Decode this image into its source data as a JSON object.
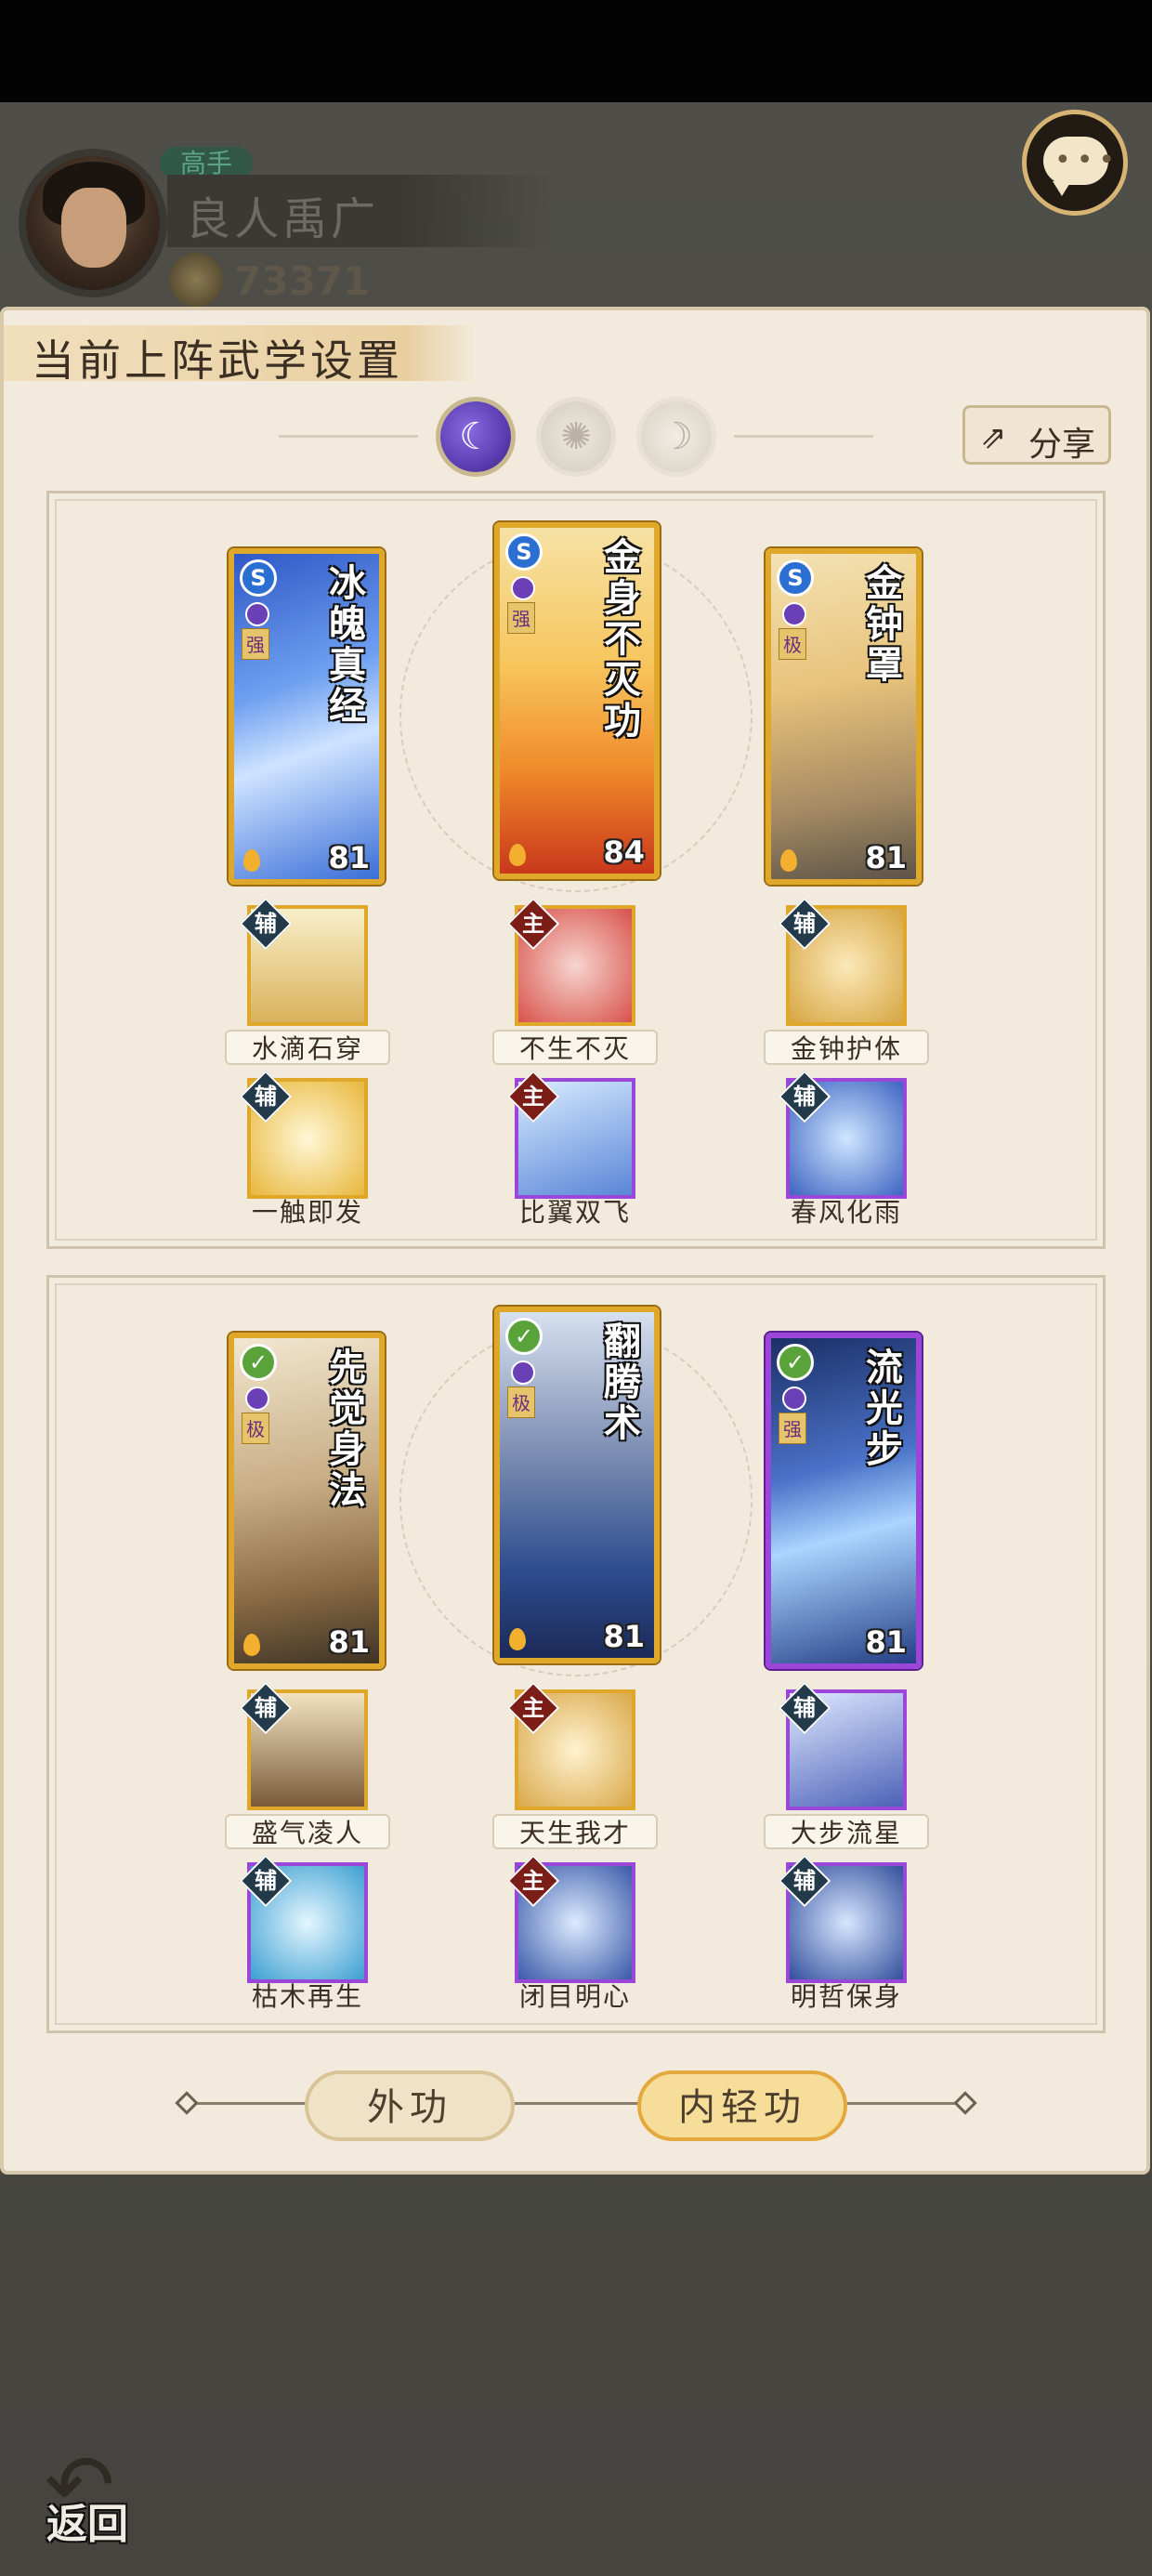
{
  "player": {
    "rank": "高手",
    "name": "良人禹广",
    "coins": "73371"
  },
  "panel": {
    "title": "当前上阵武学设置",
    "share_label": "分享",
    "tabs": [
      {
        "icon": "purple-moon-icon",
        "active": true
      },
      {
        "icon": "sun-icon",
        "active": false
      },
      {
        "icon": "crescent-icon",
        "active": false
      }
    ]
  },
  "section1": {
    "cards": [
      {
        "title": "冰魄真经",
        "tier": "强",
        "level": "81",
        "type": "S"
      },
      {
        "title": "金身不灭功",
        "tier": "强",
        "level": "84",
        "type": "S"
      },
      {
        "title": "金钟罩",
        "tier": "极",
        "level": "81",
        "type": "S"
      }
    ],
    "skills_row1": [
      {
        "label": "水滴石穿",
        "badge": "辅"
      },
      {
        "label": "不生不灭",
        "badge": "主"
      },
      {
        "label": "金钟护体",
        "badge": "辅"
      }
    ],
    "skills_row2": [
      {
        "label": "一触即发",
        "badge": "辅"
      },
      {
        "label": "比翼双飞",
        "badge": "主"
      },
      {
        "label": "春风化雨",
        "badge": "辅"
      }
    ]
  },
  "section2": {
    "cards": [
      {
        "title": "先觉身法",
        "tier": "极",
        "level": "81"
      },
      {
        "title": "翻腾术",
        "tier": "极",
        "level": "81"
      },
      {
        "title": "流光步",
        "tier": "强",
        "level": "81"
      }
    ],
    "skills_row1": [
      {
        "label": "盛气凌人",
        "badge": "辅"
      },
      {
        "label": "天生我才",
        "badge": "主"
      },
      {
        "label": "大步流星",
        "badge": "辅"
      }
    ],
    "skills_row2": [
      {
        "label": "枯木再生",
        "badge": "辅"
      },
      {
        "label": "闭目明心",
        "badge": "主"
      },
      {
        "label": "明哲保身",
        "badge": "辅"
      }
    ]
  },
  "bottom_tabs": {
    "outer": "外功",
    "inner": "内轻功"
  },
  "back_label": "返回",
  "colors": {
    "gold_frame": "#e0a82a",
    "purple_frame": "#9a46d8",
    "panel_bg": "#f2ebdd"
  }
}
